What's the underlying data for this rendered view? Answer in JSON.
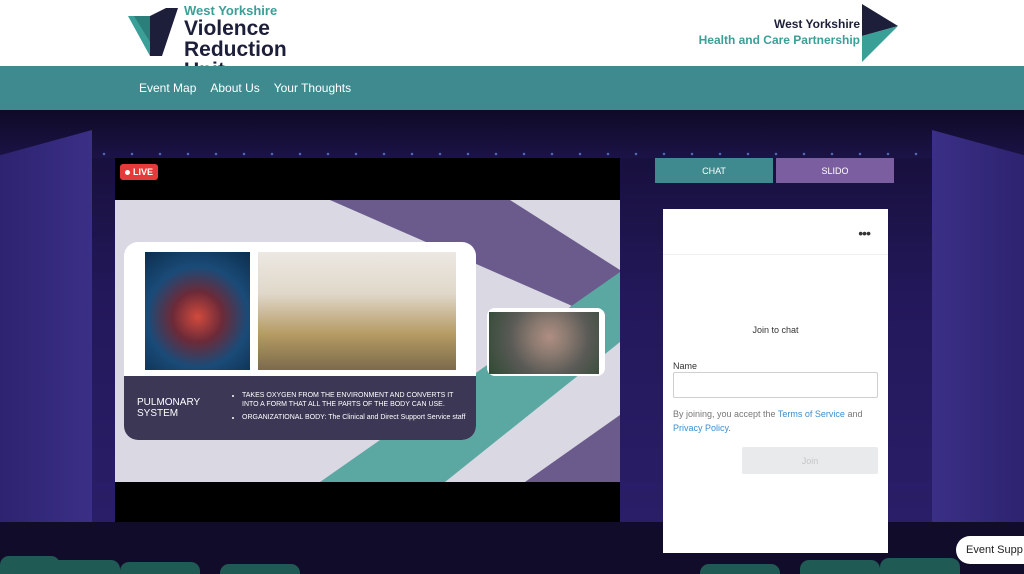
{
  "header": {
    "vru": {
      "line1": "West Yorkshire",
      "line2": "Violence",
      "line3": "Reduction Unit"
    },
    "hcp": {
      "line1": "West Yorkshire",
      "line2": "Health and Care Partnership"
    }
  },
  "nav": {
    "items": [
      {
        "label": "Event Map"
      },
      {
        "label": "About Us"
      },
      {
        "label": "Your Thoughts"
      }
    ]
  },
  "video": {
    "live_label": "LIVE",
    "slide": {
      "caption_title": "PULMONARY SYSTEM",
      "bullets": [
        "TAKES OXYGEN FROM THE ENVIRONMENT AND CONVERTS IT INTO A FORM THAT ALL THE PARTS OF THE BODY CAN USE.",
        "ORGANIZATIONAL BODY: The Clinical and Direct Support Service staff"
      ]
    }
  },
  "tabs": {
    "chat": "CHAT",
    "slido": "SLIDO"
  },
  "chat": {
    "menu_icon": "more-dots-icon",
    "join_title": "Join to chat",
    "name_label": "Name",
    "name_value": "",
    "terms_prefix": "By joining, you accept the ",
    "terms_link": "Terms of Service",
    "terms_and": " and ",
    "privacy_link": "Privacy Policy",
    "terms_suffix": ".",
    "join_button": "Join"
  },
  "support": {
    "label": "Event Supp"
  },
  "colors": {
    "teal": "#3f8a8f",
    "purple": "#7b5ea0",
    "navy": "#1d1f3a",
    "live_red": "#e53a3a"
  }
}
